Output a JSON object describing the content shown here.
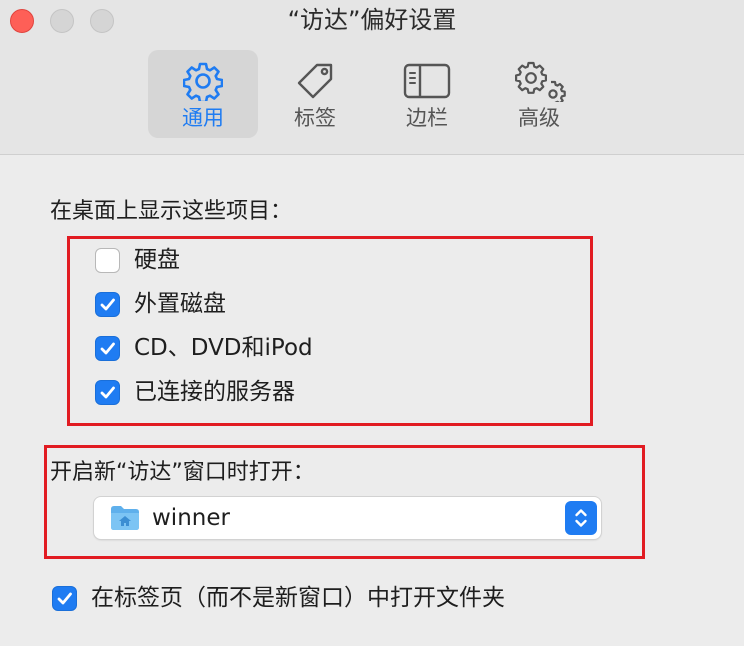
{
  "window": {
    "title": "“访达”偏好设置"
  },
  "toolbar": {
    "tabs": [
      {
        "label": "通用",
        "icon": "gear-icon",
        "selected": true
      },
      {
        "label": "标签",
        "icon": "tag-icon",
        "selected": false
      },
      {
        "label": "边栏",
        "icon": "sidebar-icon",
        "selected": false
      },
      {
        "label": "高级",
        "icon": "gears-icon",
        "selected": false
      }
    ]
  },
  "desktop_items": {
    "heading": "在桌面上显示这些项目：",
    "items": [
      {
        "label": "硬盘",
        "checked": false
      },
      {
        "label": "外置磁盘",
        "checked": true
      },
      {
        "label": "CD、DVD和iPod",
        "checked": true
      },
      {
        "label": "已连接的服务器",
        "checked": true
      }
    ]
  },
  "new_window": {
    "heading": "开启新“访达”窗口时打开：",
    "selected_value": "winner",
    "icon": "home-folder-icon"
  },
  "open_folders_in_tabs": {
    "label": "在标签页（而不是新窗口）中打开文件夹",
    "checked": true
  },
  "colors": {
    "accent": "#1f7cf2",
    "highlight_box": "#e11b22",
    "close_button": "#fe5f57"
  }
}
